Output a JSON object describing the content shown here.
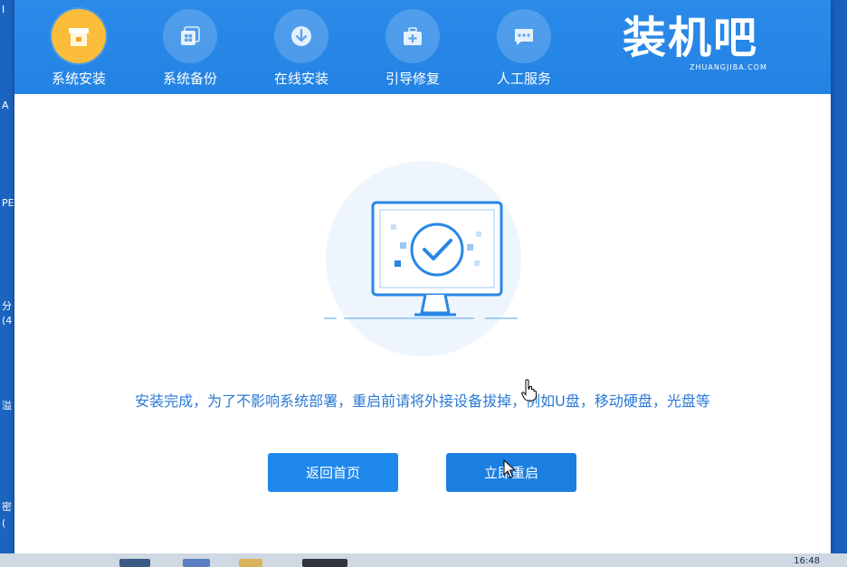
{
  "desktop": {
    "left_fragments": [
      "I",
      "A",
      "PE",
      "分",
      "(4",
      "溢",
      "密",
      "("
    ]
  },
  "window": {
    "nav": [
      {
        "label": "系统安装",
        "icon": "box-install-icon",
        "active": true
      },
      {
        "label": "系统备份",
        "icon": "windows-backup-icon",
        "active": false
      },
      {
        "label": "在线安装",
        "icon": "download-icon",
        "active": false
      },
      {
        "label": "引导修复",
        "icon": "toolbox-repair-icon",
        "active": false
      },
      {
        "label": "人工服务",
        "icon": "chat-service-icon",
        "active": false
      }
    ],
    "brand": {
      "name": "装机吧",
      "domain": "ZHUANGJIBA.COM"
    }
  },
  "main": {
    "illustration": "monitor-check-icon",
    "message": "安装完成，为了不影响系统部署，重启前请将外接设备拔掉，例如U盘，移动硬盘，光盘等",
    "buttons": {
      "home": "返回首页",
      "restart": "立即重启"
    }
  },
  "taskbar": {
    "clock": "16:48"
  },
  "colors": {
    "header": "#2383e4",
    "accent": "#1e88ec",
    "active_nav": "#fbbd3a",
    "message": "#2a7ad6"
  }
}
